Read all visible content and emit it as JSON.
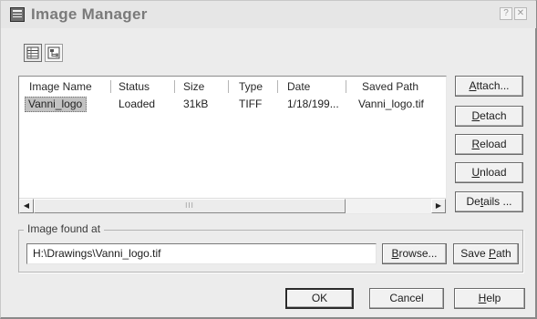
{
  "window": {
    "title": "Image Manager",
    "help_glyph": "?",
    "close_glyph": "✕"
  },
  "toolbar": {
    "list_view_icon": "list-view-icon",
    "tree_view_icon": "tree-view-icon"
  },
  "image_list": {
    "columns": [
      "Image Name",
      "Status",
      "Size",
      "Type",
      "Date",
      "Saved Path"
    ],
    "rows": [
      {
        "name": "Vanni_logo",
        "status": "Loaded",
        "size": "31kB",
        "type": "TIFF",
        "date": "1/18/199...",
        "saved_path": "Vanni_logo.tif",
        "selected": true
      }
    ],
    "scroll_left_glyph": "◀",
    "scroll_right_glyph": "▶",
    "thumb_grip": "III"
  },
  "side_buttons": {
    "attach": {
      "prefix": "",
      "key": "A",
      "suffix": "ttach..."
    },
    "detach": {
      "prefix": "",
      "key": "D",
      "suffix": "etach"
    },
    "reload": {
      "prefix": "",
      "key": "R",
      "suffix": "eload"
    },
    "unload": {
      "prefix": "",
      "key": "U",
      "suffix": "nload"
    },
    "details": {
      "prefix": "De",
      "key": "t",
      "suffix": "ails ..."
    }
  },
  "found_at": {
    "legend": "Image found at",
    "path": "H:\\Drawings\\Vanni_logo.tif",
    "browse": {
      "prefix": "",
      "key": "B",
      "suffix": "rowse..."
    },
    "save_path": {
      "prefix": "Save ",
      "key": "P",
      "suffix": "ath"
    }
  },
  "footer": {
    "ok": "OK",
    "cancel": "Cancel",
    "help": {
      "prefix": "",
      "key": "H",
      "suffix": "elp"
    }
  },
  "colors": {
    "dialog_bg": "#ececec",
    "selection_bg": "#c2c2c2",
    "title_text": "#7a7a7a"
  }
}
